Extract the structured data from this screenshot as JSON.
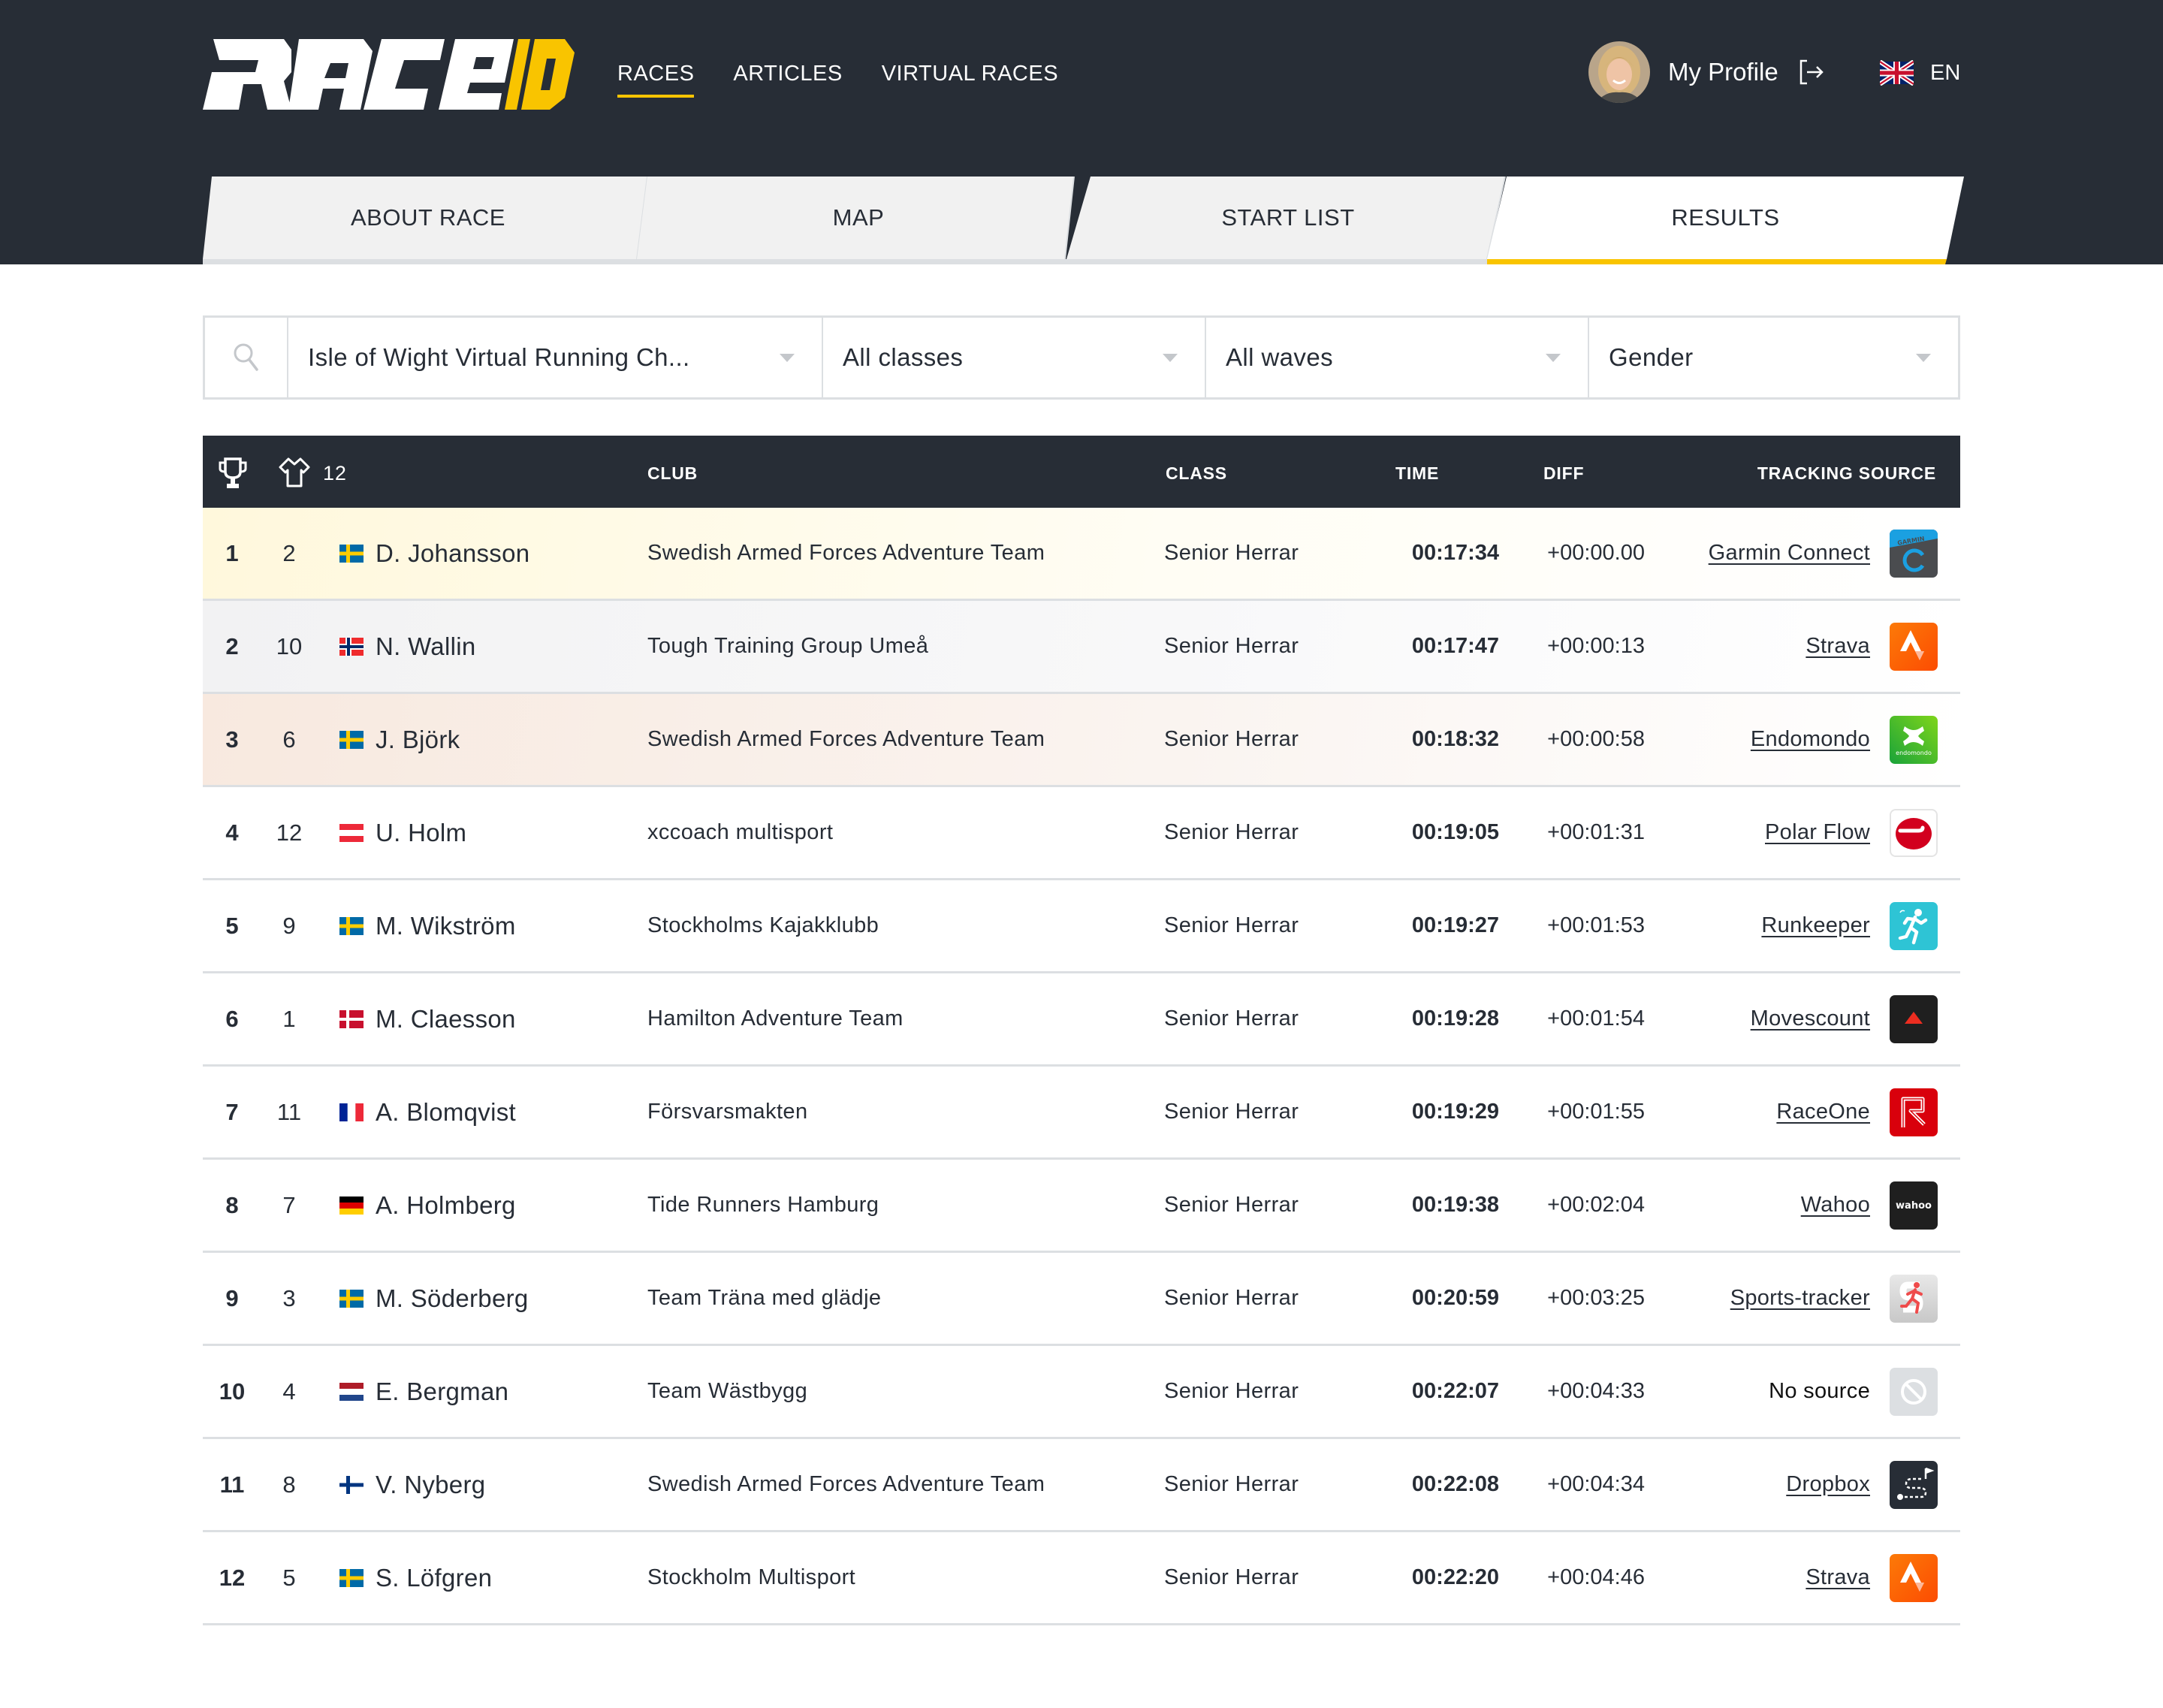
{
  "brand": {
    "logo_text_main": "RACE",
    "logo_text_accent": "ID",
    "accent_color": "#f9c400",
    "dark_color": "#272d36"
  },
  "nav": {
    "items": [
      {
        "label": "RACES",
        "active": true
      },
      {
        "label": "ARTICLES",
        "active": false
      },
      {
        "label": "VIRTUAL RACES",
        "active": false
      }
    ]
  },
  "profile": {
    "label": "My Profile",
    "logout_icon": "logout-icon"
  },
  "language": {
    "label": "EN",
    "flag": "gb"
  },
  "tabs": [
    {
      "label": "ABOUT RACE",
      "active": false
    },
    {
      "label": "MAP",
      "active": false
    },
    {
      "label": "START LIST",
      "active": false
    },
    {
      "label": "RESULTS",
      "active": true
    }
  ],
  "filters": {
    "search_icon": "search-icon",
    "race": "Isle of Wight Virtual Running Ch...",
    "class": "All classes",
    "wave": "All waves",
    "gender": "Gender"
  },
  "table": {
    "headers": {
      "place_icon": "trophy-icon",
      "bib_icon": "shirt-icon",
      "participants_count": "12",
      "club": "CLUB",
      "class": "CLASS",
      "time": "TIME",
      "diff": "DIFF",
      "tracking_source": "TRACKING SOURCE"
    },
    "rows": [
      {
        "place": "1",
        "bib": "2",
        "flag": "se",
        "name": "D. Johansson",
        "club": "Swedish Armed Forces Adventure Team",
        "class": "Senior Herrar",
        "time": "00:17:34",
        "diff": "+00:00.00",
        "source": "Garmin Connect",
        "source_icon": "garmin",
        "linked": true,
        "medal": "gold"
      },
      {
        "place": "2",
        "bib": "10",
        "flag": "no",
        "name": "N. Wallin",
        "club": "Tough Training Group Umeå",
        "class": "Senior Herrar",
        "time": "00:17:47",
        "diff": "+00:00:13",
        "source": "Strava",
        "source_icon": "strava",
        "linked": true,
        "medal": "silver"
      },
      {
        "place": "3",
        "bib": "6",
        "flag": "se",
        "name": "J. Björk",
        "club": "Swedish Armed Forces Adventure Team",
        "class": "Senior Herrar",
        "time": "00:18:32",
        "diff": "+00:00:58",
        "source": "Endomondo",
        "source_icon": "endomondo",
        "linked": true,
        "medal": "bronze"
      },
      {
        "place": "4",
        "bib": "12",
        "flag": "at",
        "name": "U. Holm",
        "club": "xccoach multisport",
        "class": "Senior Herrar",
        "time": "00:19:05",
        "diff": "+00:01:31",
        "source": "Polar Flow",
        "source_icon": "polar",
        "linked": true,
        "medal": ""
      },
      {
        "place": "5",
        "bib": "9",
        "flag": "se",
        "name": "M. Wikström",
        "club": "Stockholms Kajakklubb",
        "class": "Senior Herrar",
        "time": "00:19:27",
        "diff": "+00:01:53",
        "source": "Runkeeper",
        "source_icon": "runkeeper",
        "linked": true,
        "medal": ""
      },
      {
        "place": "6",
        "bib": "1",
        "flag": "dk",
        "name": "M. Claesson",
        "club": "Hamilton Adventure Team",
        "class": "Senior Herrar",
        "time": "00:19:28",
        "diff": "+00:01:54",
        "source": "Movescount",
        "source_icon": "movescount",
        "linked": true,
        "medal": ""
      },
      {
        "place": "7",
        "bib": "11",
        "flag": "fr",
        "name": "A. Blomqvist",
        "club": "Försvarsmakten",
        "class": "Senior Herrar",
        "time": "00:19:29",
        "diff": "+00:01:55",
        "source": "RaceOne",
        "source_icon": "raceone",
        "linked": true,
        "medal": ""
      },
      {
        "place": "8",
        "bib": "7",
        "flag": "de",
        "name": "A. Holmberg",
        "club": "Tide Runners Hamburg",
        "class": "Senior Herrar",
        "time": "00:19:38",
        "diff": "+00:02:04",
        "source": "Wahoo",
        "source_icon": "wahoo",
        "linked": true,
        "medal": ""
      },
      {
        "place": "9",
        "bib": "3",
        "flag": "se",
        "name": "M. Söderberg",
        "club": "Team Träna med glädje",
        "class": "Senior Herrar",
        "time": "00:20:59",
        "diff": "+00:03:25",
        "source": "Sports-tracker",
        "source_icon": "sportstracker",
        "linked": true,
        "medal": ""
      },
      {
        "place": "10",
        "bib": "4",
        "flag": "nl",
        "name": "E. Bergman",
        "club": "Team Wästbygg",
        "class": "Senior Herrar",
        "time": "00:22:07",
        "diff": "+00:04:33",
        "source": "No source",
        "source_icon": "nosource",
        "linked": false,
        "medal": ""
      },
      {
        "place": "11",
        "bib": "8",
        "flag": "fi",
        "name": "V. Nyberg",
        "club": "Swedish Armed Forces Adventure Team",
        "class": "Senior Herrar",
        "time": "00:22:08",
        "diff": "+00:04:34",
        "source": "Dropbox",
        "source_icon": "dropbox",
        "linked": true,
        "medal": ""
      },
      {
        "place": "12",
        "bib": "5",
        "flag": "se",
        "name": "S. Löfgren",
        "club": "Stockholm Multisport",
        "class": "Senior Herrar",
        "time": "00:22:20",
        "diff": "+00:04:46",
        "source": "Strava",
        "source_icon": "strava",
        "linked": true,
        "medal": ""
      }
    ]
  }
}
